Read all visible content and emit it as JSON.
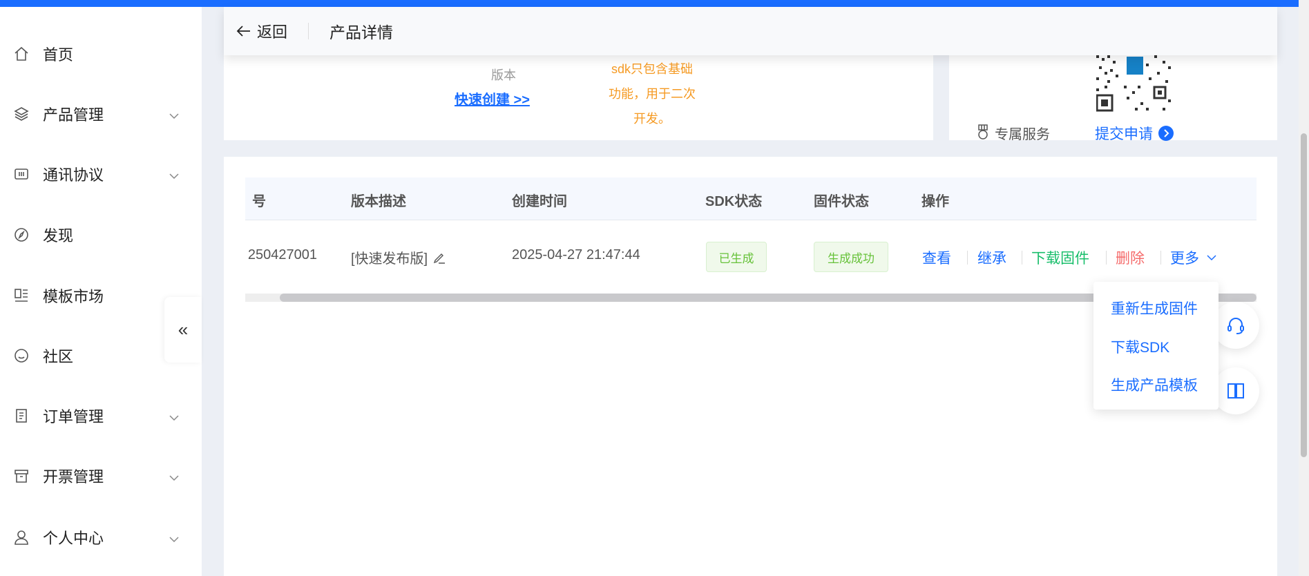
{
  "header": {
    "back_label": "返回",
    "title": "产品详情"
  },
  "sidebar": {
    "items": [
      {
        "label": "首页",
        "icon": "home-icon",
        "expandable": false
      },
      {
        "label": "产品管理",
        "icon": "layers-icon",
        "expandable": true
      },
      {
        "label": "通讯协议",
        "icon": "protocol-icon",
        "expandable": true
      },
      {
        "label": "发现",
        "icon": "compass-icon",
        "expandable": false
      },
      {
        "label": "模板市场",
        "icon": "template-icon",
        "expandable": false
      },
      {
        "label": "社区",
        "icon": "smile-icon",
        "expandable": false
      },
      {
        "label": "订单管理",
        "icon": "order-icon",
        "expandable": true
      },
      {
        "label": "开票管理",
        "icon": "invoice-icon",
        "expandable": true
      },
      {
        "label": "个人中心",
        "icon": "user-icon",
        "expandable": true
      }
    ]
  },
  "top_card": {
    "grey_text": "版本",
    "quick_create": "快速创建 >>",
    "orange_lines": [
      "sdk只包含基础",
      "功能，用于二次",
      "开发。"
    ]
  },
  "service_card": {
    "service_label": "专属服务",
    "submit_label": "提交申请"
  },
  "table": {
    "headers": [
      "号",
      "版本描述",
      "创建时间",
      "SDK状态",
      "固件状态",
      "操作"
    ],
    "rows": [
      {
        "version": "250427001",
        "desc": "[快速发布版]",
        "created": "2025-04-27 21:47:44",
        "sdk_status": "已生成",
        "fw_status": "生成成功"
      }
    ],
    "actions": {
      "view": "查看",
      "inherit": "继承",
      "download_fw": "下载固件",
      "delete": "删除",
      "more": "更多"
    }
  },
  "more_menu": [
    "重新生成固件",
    "下载SDK",
    "生成产品模板"
  ],
  "colors": {
    "primary": "#1a6dff",
    "success": "#19be6b",
    "danger": "#f56c6c",
    "warning": "#f59a23"
  }
}
